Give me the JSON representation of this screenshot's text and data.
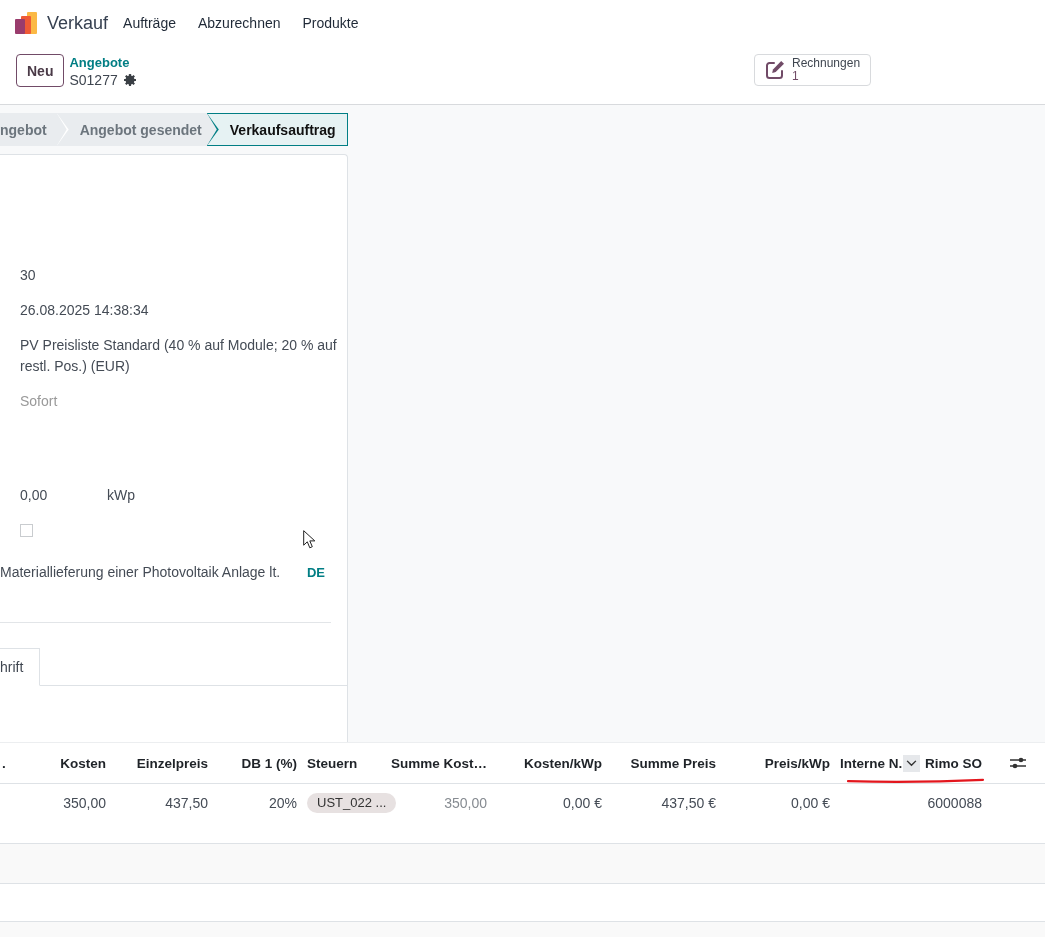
{
  "app": {
    "name": "Verkauf",
    "menu": [
      "Aufträge",
      "Abzurechnen",
      "Produkte"
    ]
  },
  "control_panel": {
    "new_button": "Neu",
    "breadcrumb": "Angebote",
    "record": "S01277",
    "smart_button": {
      "label": "Rechnungen",
      "count": "1"
    }
  },
  "status_bar": [
    {
      "label": "ngebot",
      "selected": false
    },
    {
      "label": "Angebot gesendet",
      "selected": false
    },
    {
      "label": "Verkaufsauftrag",
      "selected": true
    }
  ],
  "form": {
    "groups": [
      {
        "fields": [
          {
            "kind": "text",
            "value": "30"
          },
          {
            "kind": "text",
            "value": "26.08.2025 14:38:34"
          },
          {
            "kind": "text",
            "value": "PV Preisliste Standard (40 % auf Module; 20 % auf restl. Pos.) (EUR)"
          },
          {
            "kind": "input",
            "placeholder": "Sofort"
          }
        ]
      },
      {
        "fields": [
          {
            "kind": "measure",
            "value": "0,00",
            "unit": "kWp"
          },
          {
            "kind": "checkbox",
            "checked": false
          },
          {
            "kind": "translatable",
            "value": "Materiallieferung einer Photovoltaik Anlage lt.",
            "language": "DE"
          }
        ]
      }
    ],
    "notebook_tabs": [
      {
        "label": "hrift",
        "selected": true
      }
    ]
  },
  "order_lines": {
    "columns": [
      {
        "label": ".",
        "kind": "text",
        "dropdown": false
      },
      {
        "label": "Kosten",
        "kind": "number",
        "dropdown": false
      },
      {
        "label": "Einzelpreis",
        "kind": "number",
        "dropdown": false
      },
      {
        "label": "DB 1 (%)",
        "kind": "number",
        "dropdown": false
      },
      {
        "label": "Steuern",
        "kind": "text",
        "dropdown": false
      },
      {
        "label": "Summe Kost…",
        "kind": "number",
        "dropdown": false
      },
      {
        "label": "Kosten/kWp",
        "kind": "number",
        "dropdown": false
      },
      {
        "label": "Summe Preis",
        "kind": "number",
        "dropdown": false
      },
      {
        "label": "Preis/kWp",
        "kind": "number",
        "dropdown": false
      },
      {
        "label": "Interne N.",
        "kind": "text",
        "dropdown": true
      },
      {
        "label": "Rimo SO",
        "kind": "number",
        "dropdown": false
      }
    ],
    "rows": [
      {
        "cells": [
          null,
          {
            "kind": "value",
            "text": "350,00"
          },
          {
            "kind": "value",
            "text": "437,50"
          },
          {
            "kind": "value",
            "text": "20%"
          },
          {
            "kind": "tag",
            "text": "UST_022 ..."
          },
          {
            "kind": "readonly",
            "text": "350,00"
          },
          {
            "kind": "value",
            "text": "0,00 €"
          },
          {
            "kind": "value",
            "text": "437,50 €"
          },
          {
            "kind": "value",
            "text": "0,00 €"
          },
          null,
          {
            "kind": "value",
            "text": "6000088"
          }
        ]
      }
    ]
  }
}
